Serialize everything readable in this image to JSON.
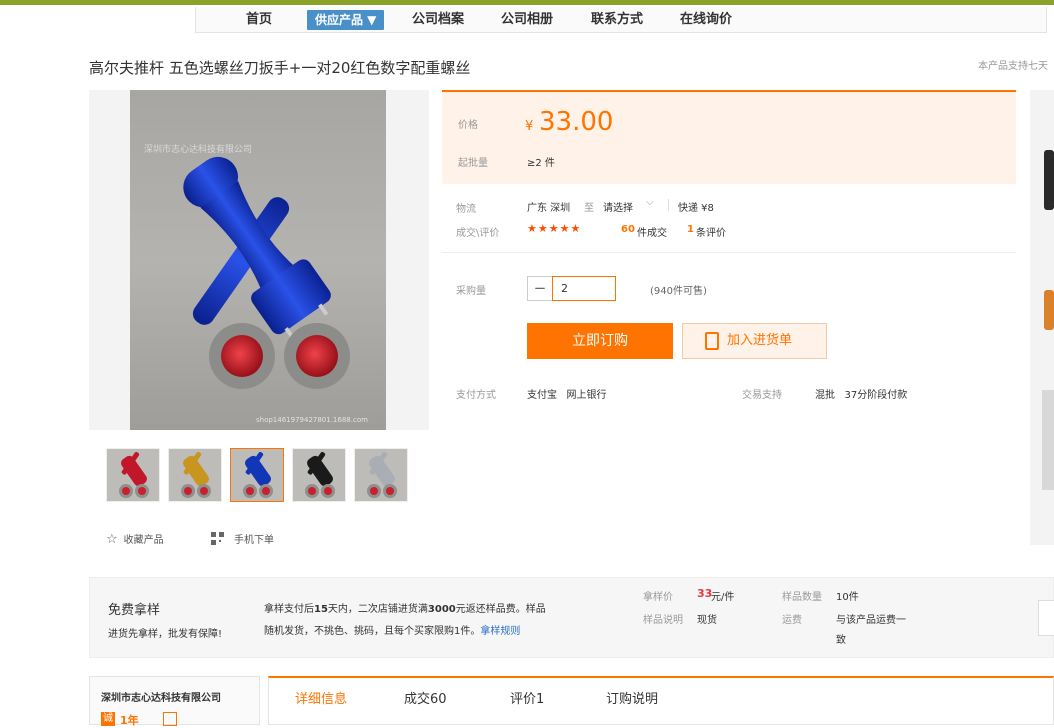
{
  "nav": {
    "items": [
      "首页",
      "供应产品 ▼",
      "公司档案",
      "公司相册",
      "联系方式",
      "在线询价"
    ]
  },
  "product": {
    "title": "高尔夫推杆 五色选螺丝刀扳手+一对20红色数字配重螺丝",
    "support_note": "本产品支持七天",
    "watermark_top": "深圳市志心达科技有限公司",
    "watermark_bottom": "shop1461979427801.1688.com"
  },
  "gallery": {
    "thumb_colors": [
      "red",
      "gold",
      "blue",
      "black",
      "silver"
    ],
    "thumb_hex": [
      "#c0182a",
      "#c8951f",
      "#1236b8",
      "#1a1a1a",
      "#a9aeb5"
    ],
    "selected_index": 2
  },
  "actions": {
    "favorite": "收藏产品",
    "mobile": "手机下单"
  },
  "price": {
    "label": "价格",
    "currency": "¥",
    "amount": "33.00",
    "moq_label": "起批量",
    "moq_value": "≥2 件"
  },
  "logistics": {
    "label": "物流",
    "origin": "广东 深圳",
    "to": "至",
    "dest": "请选择",
    "express": "快递 ¥8"
  },
  "deals": {
    "label": "成交\\评价",
    "stars": "★★★★★",
    "sold_count": "60",
    "sold_suffix": "件成交",
    "review_count": "1",
    "review_suffix": "条评价"
  },
  "purchase": {
    "qty_label": "采购量",
    "minus": "−",
    "qty_value": "2",
    "available": "(940件可售)",
    "buy_label": "立即订购",
    "cart_label": "加入进货单"
  },
  "payment": {
    "label": "支付方式",
    "methods": "支付宝   网上银行",
    "trade_label": "交易支持",
    "trade_value": "混批   37分阶段付款"
  },
  "sample": {
    "title": "免费拿样",
    "subtitle": "进货先拿样，批发有保障!",
    "desc_line1_a": "拿样支付后",
    "desc_line1_b": "15",
    "desc_line1_c": "天内，二次店铺进货满",
    "desc_line1_d": "3000",
    "desc_line1_e": "元返还样品费。样品",
    "desc_line2": "随机发货，不挑色、挑码，且每个买家限购1件。",
    "rules_link": "拿样规则",
    "price_label": "拿样价",
    "price_value": "33",
    "price_unit": "元/件",
    "note_label": "样品说明",
    "note_value": "现货",
    "count_label": "样品数量",
    "count_value": "10件",
    "freight_label": "运费",
    "freight_line1": "与该产品运费一",
    "freight_line2": "致"
  },
  "company": {
    "name": "深圳市志心达科技有限公司",
    "years_badge": "诚",
    "years": "1年"
  },
  "tabs": [
    "详细信息",
    "成交60",
    "评价1",
    "订购说明"
  ]
}
